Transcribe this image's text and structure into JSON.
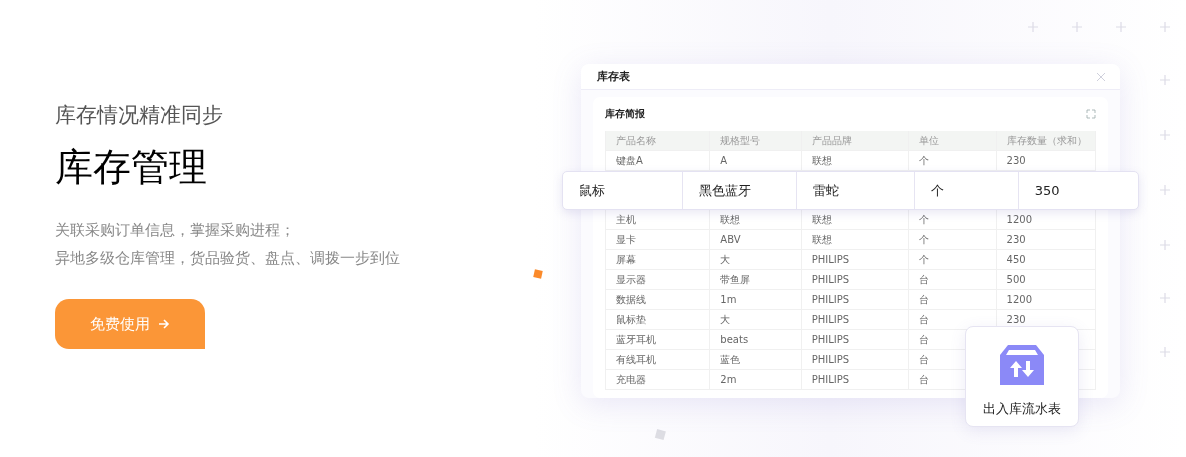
{
  "hero": {
    "subtitle": "库存情况精准同步",
    "title": "库存管理",
    "description": [
      "关联采购订单信息，掌握采购进程；",
      "异地多级仓库管理，货品验货、盘点、调拨一步到位"
    ],
    "cta": {
      "label": "免费使用"
    }
  },
  "window": {
    "title": "库存表",
    "panel": {
      "title": "库存简报",
      "columns": [
        "产品名称",
        "规格型号",
        "产品品牌",
        "单位",
        "库存数量（求和）"
      ],
      "rows": [
        {
          "kind": "plain",
          "cells": [
            "键盘A",
            "A",
            "联想",
            "个",
            "230"
          ]
        },
        {
          "kind": "raised",
          "cells": [
            "鼠标",
            "黑色蓝牙",
            "雷蛇",
            "个",
            "350"
          ]
        },
        {
          "kind": "plain",
          "cells": [
            "主机",
            "联想",
            "联想",
            "个",
            "1200"
          ]
        },
        {
          "kind": "plain",
          "cells": [
            "显卡",
            "ABV",
            "联想",
            "个",
            "230"
          ]
        },
        {
          "kind": "plain",
          "cells": [
            "屏幕",
            "大",
            "PHILIPS",
            "个",
            "450"
          ]
        },
        {
          "kind": "plain",
          "cells": [
            "显示器",
            "带鱼屏",
            "PHILIPS",
            "台",
            "500"
          ]
        },
        {
          "kind": "plain",
          "cells": [
            "数据线",
            "1m",
            "PHILIPS",
            "台",
            "1200"
          ]
        },
        {
          "kind": "plain",
          "cells": [
            "鼠标垫",
            "大",
            "PHILIPS",
            "台",
            "230"
          ]
        },
        {
          "kind": "plain",
          "cells": [
            "蓝牙耳机",
            "beats",
            "PHILIPS",
            "台"
          ]
        },
        {
          "kind": "plain",
          "cells": [
            "有线耳机",
            "蓝色",
            "PHILIPS",
            "台"
          ]
        },
        {
          "kind": "plain",
          "cells": [
            "充电器",
            "2m",
            "PHILIPS",
            "台"
          ]
        }
      ]
    }
  },
  "feature_card": {
    "label": "出入库流水表"
  }
}
